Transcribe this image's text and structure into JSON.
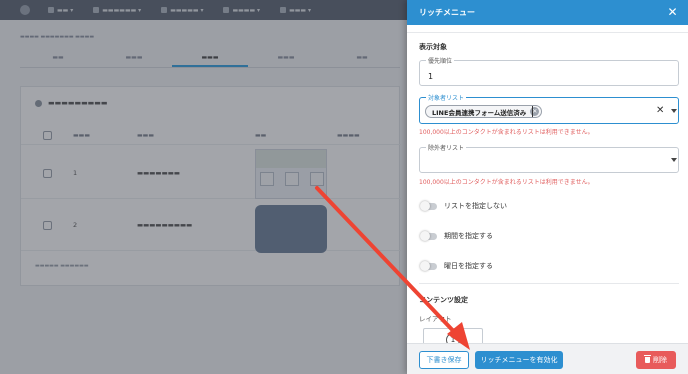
{
  "panel": {
    "title": "リッチメニュー",
    "close_icon": "close-icon"
  },
  "display_target": {
    "section_title": "表示対象",
    "priority": {
      "label": "優先順位",
      "value": "1"
    },
    "target_list": {
      "label": "対象者リスト",
      "chip": "LINE会員連携フォーム送信済み",
      "warning": "100,000以上のコンタクトが含まれるリストは利用できません。"
    },
    "exclude_list": {
      "label": "除外者リスト",
      "value": "",
      "warning": "100,000以上のコンタクトが含まれるリストは利用できません。"
    },
    "toggles": [
      {
        "label": "リストを指定しない",
        "on": false
      },
      {
        "label": "期間を指定する",
        "on": false
      },
      {
        "label": "曜日を指定する",
        "on": false
      }
    ]
  },
  "contents": {
    "section_title": "コンテンツ設定",
    "layout_label": "レイアウト",
    "layout_value": "1"
  },
  "footer": {
    "draft_label": "下書き保存",
    "activate_label": "リッチメニューを有効化",
    "delete_label": "削除"
  },
  "colors": {
    "accent": "#2d8fd0",
    "warning": "#e05c5c",
    "delete": "#e85b5b",
    "annotation_arrow": "#ee4433"
  }
}
